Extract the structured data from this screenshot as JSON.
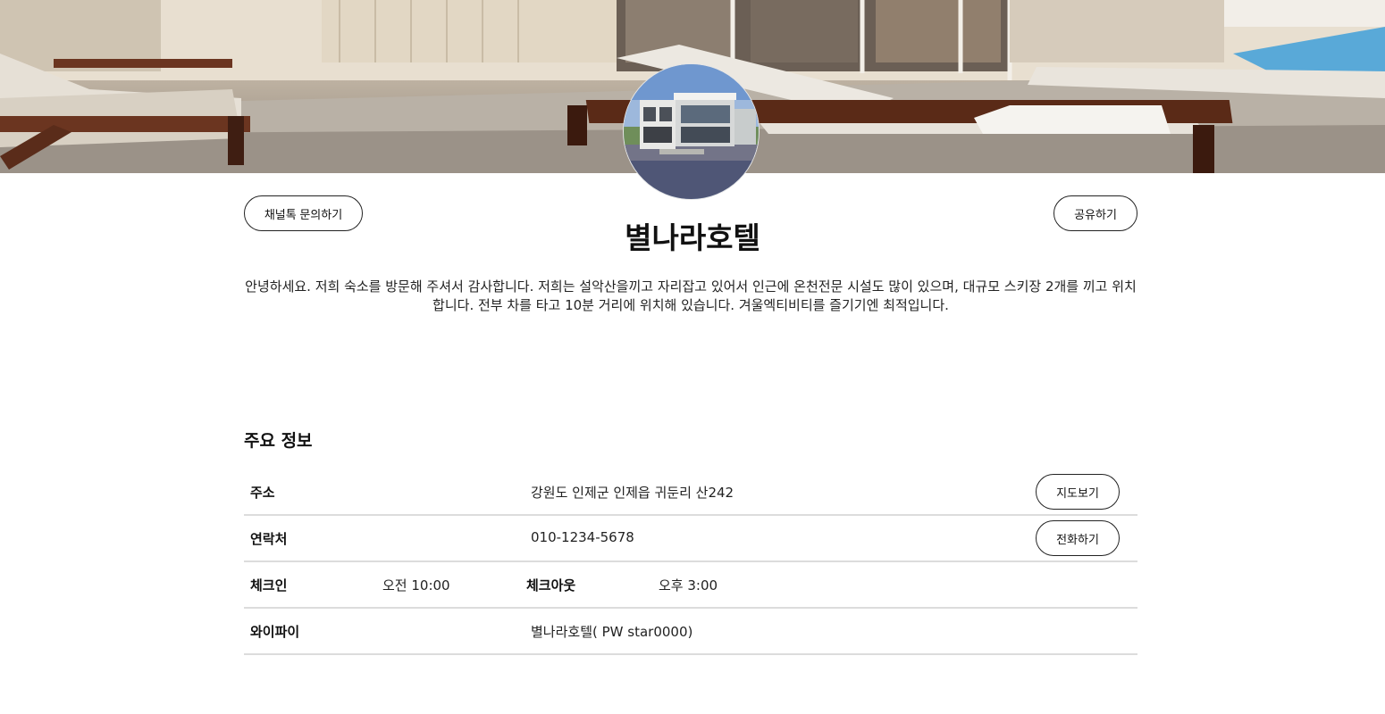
{
  "hotel": {
    "name": "별나라호텔",
    "description": "안녕하세요. 저희 숙소를 방문해 주셔서 감사합니다. 저희는 설악산을끼고 자리잡고 있어서 인근에 온천전문 시설도 많이 있으며, 대규모 스키장 2개를 끼고 위치합니다. 전부 차를 타고 10분 거리에 위치해 있습니다. 겨울엑티비티를 즐기기엔 최적입니다."
  },
  "actions": {
    "channel_talk": "채널톡 문의하기",
    "share": "공유하기"
  },
  "info": {
    "section_title": "주요 정보",
    "address_label": "주소",
    "address_value": "강원도 인제군 인제읍 귀둔리 산242",
    "map_button": "지도보기",
    "contact_label": "연락처",
    "contact_value": "010-1234-5678",
    "call_button": "전화하기",
    "checkin_label": "체크인",
    "checkin_value": "오전 10:00",
    "checkout_label": "체크아웃",
    "checkout_value": "오후 3:00",
    "wifi_label": "와이파이",
    "wifi_value": "별나라호텔( PW star0000)"
  },
  "icons": {
    "hero": "hotel-patio-banner-image",
    "avatar": "hotel-building-profile-image"
  }
}
